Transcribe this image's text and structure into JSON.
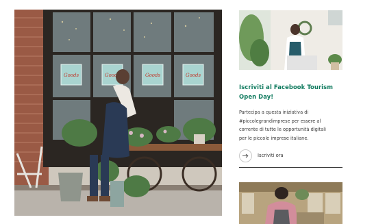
{
  "hero": {
    "image": "flower-shop-storefront-photo",
    "window_sign_text": "Goods"
  },
  "article": {
    "title_line1": "Iscriviti al Facebook Tourism",
    "title_line2": "Open Day!",
    "desc_line1": "Partecipa a questa iniziativa di",
    "desc_line2": "#piccolegrandimprese per essere al",
    "desc_line3": "corrente di tutte le opportunità digitali",
    "desc_line4": "per le piccole imprese italiane.",
    "cta_label": "Iscriviti ora",
    "cta_icon": "arrow-right-icon",
    "thumbnail": "woman-at-laptop-shop-photo"
  },
  "next_article": {
    "thumbnail": "barista-cafe-photo"
  },
  "colors": {
    "title_accent": "#0f7a5e",
    "body_text": "#3c3c3c",
    "rule": "#3d3d3d"
  }
}
